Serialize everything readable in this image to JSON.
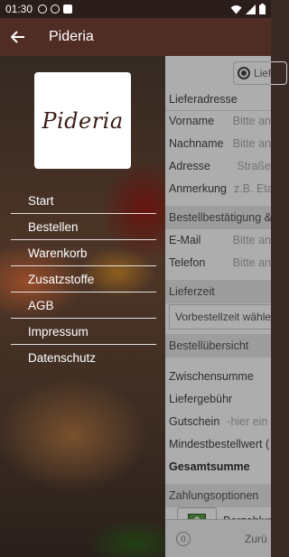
{
  "status_bar": {
    "time": "01:30",
    "icons": [
      "alert-icon",
      "data-saver-icon",
      "sim-icon"
    ],
    "right_icons": [
      "wifi-icon",
      "signal-icon",
      "battery-icon"
    ]
  },
  "app_bar": {
    "title": "Pideria",
    "back_icon": "arrow-left-icon"
  },
  "drawer": {
    "logo_text": "Pideria",
    "items": [
      {
        "label": "Start"
      },
      {
        "label": "Bestellen"
      },
      {
        "label": "Warenkorb"
      },
      {
        "label": "Zusatzstoffe"
      },
      {
        "label": "AGB"
      },
      {
        "label": "Impressum"
      },
      {
        "label": "Datenschutz"
      }
    ]
  },
  "background_form": {
    "delivery_option": "Lief",
    "lieferadresse_header": "Lieferadresse",
    "fields": [
      {
        "label": "Vorname",
        "placeholder": "Bitte an"
      },
      {
        "label": "Nachname",
        "placeholder": "Bitte an"
      },
      {
        "label": "Adresse",
        "placeholder": "Straße"
      },
      {
        "label": "Anmerkung",
        "placeholder": "z.B. Eta"
      }
    ],
    "bestaetigung_header": "Bestellbestätigung &",
    "contact_fields": [
      {
        "label": "E-Mail",
        "placeholder": "Bitte an"
      },
      {
        "label": "Telefon",
        "placeholder": "Bitte an"
      }
    ],
    "lieferzeit_header": "Lieferzeit",
    "lieferzeit_value": "Vorbestellzeit wähle",
    "uebersicht_header": "Bestellübersicht",
    "summary": {
      "zwischensumme": "Zwischensumme",
      "liefergebuehr": "Liefergebühr",
      "gutschein": "Gutschein",
      "gutschein_placeholder": "-hier ein",
      "mindestbestellwert": "Mindestbestellwert (",
      "gesamtsumme": "Gesamtsumme"
    },
    "zahlungsoptionen_header": "Zahlungsoptionen",
    "payment_label": "Barzahlun",
    "bottom": {
      "count": "0",
      "action": "Zurü"
    }
  }
}
